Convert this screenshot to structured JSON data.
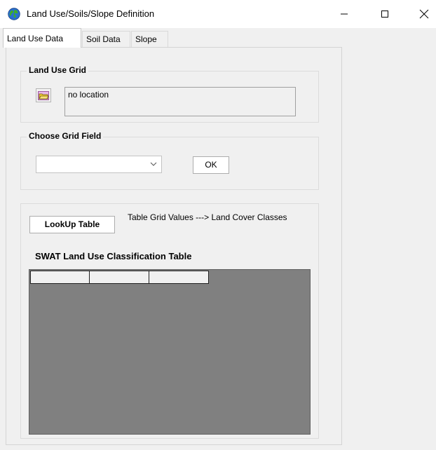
{
  "window": {
    "title": "Land Use/Soils/Slope Definition",
    "app_icon": "globe-icon",
    "controls": [
      "minimize-icon",
      "maximize-icon",
      "close-icon"
    ]
  },
  "tabs": [
    {
      "label": "Land Use Data",
      "active": true
    },
    {
      "label": "Soil Data",
      "active": false
    },
    {
      "label": "Slope",
      "active": false
    }
  ],
  "land_use_grid": {
    "group_label": "Land Use Grid",
    "folder_icon": "open-folder-icon",
    "location_text": "no location"
  },
  "grid_field": {
    "group_label": "Choose Grid Field",
    "selected_value": "",
    "ok_label": "OK"
  },
  "lookup": {
    "button_label": "LookUp Table",
    "description": "Table Grid Values ---> Land Cover Classes",
    "table_title": "SWAT Land Use Classification Table",
    "columns": [
      "",
      "",
      ""
    ]
  },
  "colors": {
    "grid_background": "#808080",
    "panel_background": "#f0f0f0",
    "titlebar_background": "#ffffff"
  }
}
